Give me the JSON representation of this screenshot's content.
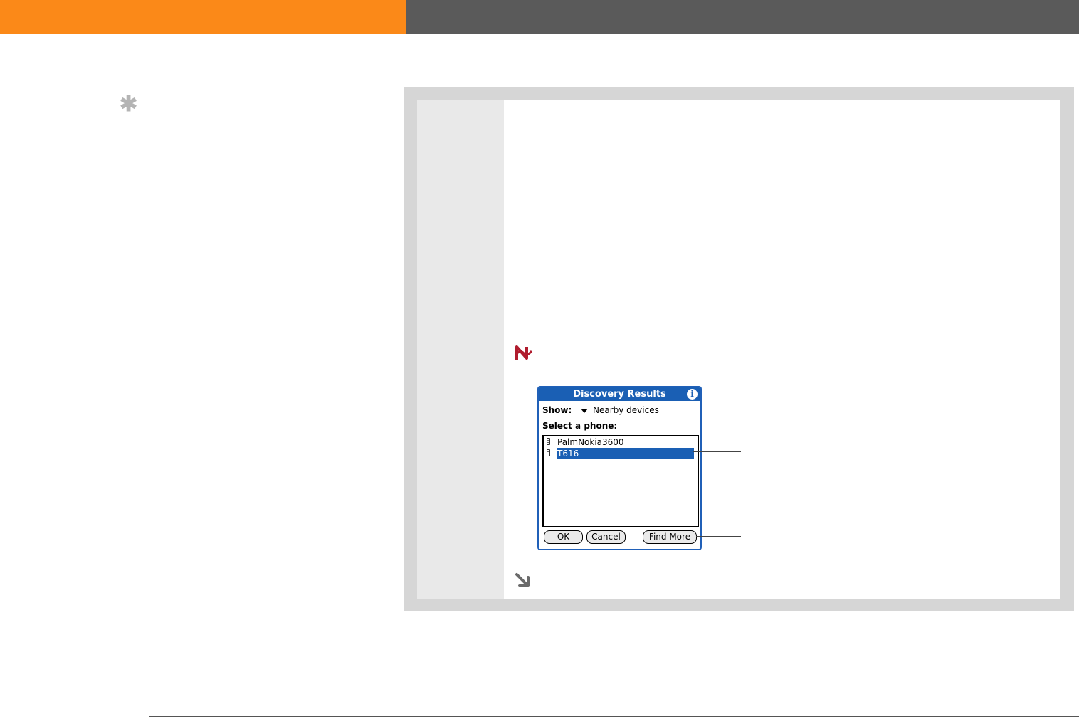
{
  "colors": {
    "header_orange": "#fb8918",
    "header_gray": "#5a5a5a",
    "panel_frame": "#d6d6d6",
    "panel_side": "#e9e9e9",
    "palm_blue": "#1a5fb4",
    "note_red": "#b01c2e"
  },
  "icons": {
    "tip": "asterisk-icon",
    "note": "note-icon",
    "continue": "arrow-down-right-icon",
    "info": "info-icon",
    "dropdown": "triangle-down-icon",
    "phone": "phone-icon"
  },
  "tip": {
    "glyph": "✱"
  },
  "dialog": {
    "title": "Discovery Results",
    "info_glyph": "i",
    "show_label": "Show:",
    "show_value": "Nearby devices",
    "select_label": "Select a phone:",
    "phones": [
      {
        "name": "PalmNokia3600",
        "selected": false
      },
      {
        "name": "T616",
        "selected": true
      }
    ],
    "buttons": {
      "ok": "OK",
      "cancel": "Cancel",
      "find_more": "Find More"
    }
  }
}
